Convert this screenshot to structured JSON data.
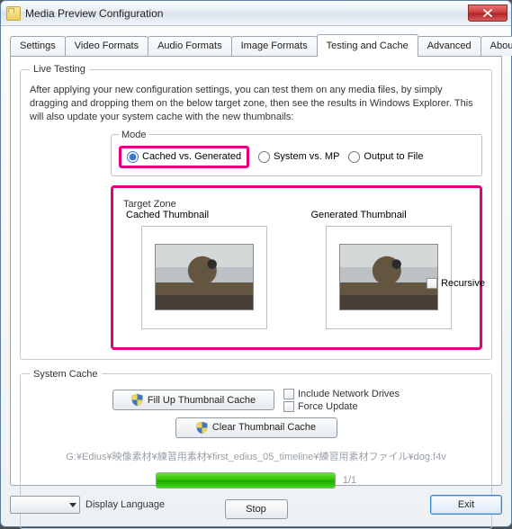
{
  "window": {
    "title": "Media Preview Configuration"
  },
  "tabs": [
    "Settings",
    "Video Formats",
    "Audio Formats",
    "Image Formats",
    "Testing and Cache",
    "Advanced",
    "About..."
  ],
  "active_tab_index": 4,
  "live_testing": {
    "legend": "Live Testing",
    "description": "After applying your new configuration settings, you can test them on any media files, by simply dragging and dropping them on the below target zone, then see the results in Windows Explorer. This will also update your system cache with the new thumbnails:",
    "mode": {
      "legend": "Mode",
      "options": [
        {
          "label": "Cached vs. Generated",
          "checked": true,
          "highlight": true
        },
        {
          "label": "System vs. MP",
          "checked": false,
          "highlight": false
        },
        {
          "label": "Output to File",
          "checked": false,
          "highlight": false
        }
      ]
    },
    "target_zone": {
      "legend": "Target Zone",
      "cached_label": "Cached Thumbnail",
      "generated_label": "Generated Thumbnail"
    },
    "recursive_label": "Recursive",
    "recursive_checked": false
  },
  "system_cache": {
    "legend": "System Cache",
    "fill_label": "Fill Up Thumbnail Cache",
    "clear_label": "Clear Thumbnail Cache",
    "include_network_label": "Include Network Drives",
    "include_network_checked": false,
    "force_update_label": "Force Update",
    "force_update_checked": false,
    "path_text": "G:¥Edius¥映像素材¥練習用素材¥first_edius_05_timeline¥練習用素材ファイル¥dog.f4v",
    "progress_value": 100,
    "progress_count": "1/1",
    "stop_label": "Stop"
  },
  "bottom": {
    "display_language_label": "Display Language",
    "exit_label": "Exit"
  }
}
